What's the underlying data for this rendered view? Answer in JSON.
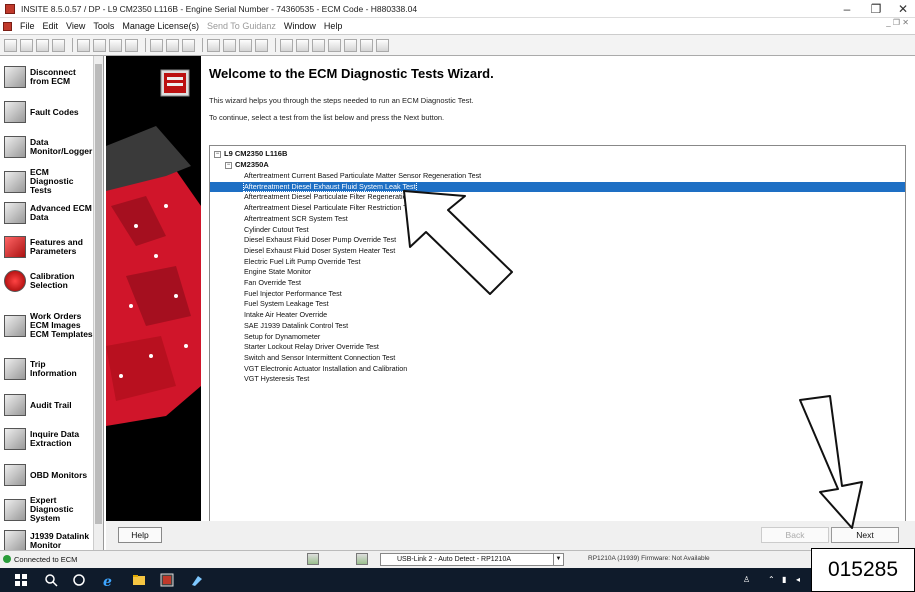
{
  "window": {
    "title": "INSITE 8.5.0.57 / DP - L9 CM2350 L116B - Engine Serial Number - 74360535 - ECM Code - H880338.04",
    "minimize": "–",
    "restore": "❐",
    "close": "✕"
  },
  "menubar": {
    "items": [
      "File",
      "Edit",
      "View",
      "Tools",
      "Manage License(s)",
      "Send To Guidanz",
      "Window",
      "Help"
    ],
    "window_controls": "_ ❐ ✕"
  },
  "sidebar": {
    "items": [
      {
        "label": "Disconnect from ECM",
        "icon": "disconnect-icon"
      },
      {
        "label": "Fault Codes",
        "icon": "fault-codes-icon"
      },
      {
        "label": "Data Monitor/Logger",
        "icon": "data-monitor-icon"
      },
      {
        "label": "ECM Diagnostic Tests",
        "icon": "diagnostic-tests-icon"
      },
      {
        "label": "Advanced ECM Data",
        "icon": "advanced-data-icon"
      },
      {
        "label": "Features and Parameters",
        "icon": "features-icon"
      },
      {
        "label": "Calibration Selection",
        "icon": "calibration-icon"
      },
      {
        "label": "Work Orders ECM Images ECM Templates",
        "icon": "work-orders-icon"
      },
      {
        "label": "Trip Information",
        "icon": "trip-icon"
      },
      {
        "label": "Audit Trail",
        "icon": "audit-icon"
      },
      {
        "label": "Inquire Data Extraction",
        "icon": "inquire-icon"
      },
      {
        "label": "OBD Monitors",
        "icon": "obd-icon"
      },
      {
        "label": "Expert Diagnostic System",
        "icon": "expert-icon"
      },
      {
        "label": "J1939 Datalink Monitor",
        "icon": "datalink-icon"
      }
    ]
  },
  "wizard": {
    "title": "Welcome to the ECM Diagnostic Tests Wizard.",
    "desc1": "This wizard helps you through the steps needed to run an ECM Diagnostic Test.",
    "desc2": "To continue, select a test from the list below and press the Next button.",
    "tree_root": "L9 CM2350 L116B",
    "tree_child": "CM2350A",
    "tests": [
      "Aftertreatment Current Based Particulate Matter Sensor Regeneration Test",
      "Aftertreatment Diesel Exhaust Fluid System Leak Test",
      "Aftertreatment Diesel Particulate Filter Regeneration",
      "Aftertreatment Diesel Particulate Filter Restriction Test",
      "Aftertreatment SCR System Test",
      "Cylinder Cutout Test",
      "Diesel Exhaust Fluid Doser Pump Override Test",
      "Diesel Exhaust Fluid Doser System Heater Test",
      "Electric Fuel Lift Pump Override Test",
      "Engine State Monitor",
      "Fan Override Test",
      "Fuel Injector Performance Test",
      "Fuel System Leakage Test",
      "Intake Air Heater Override",
      "SAE J1939 Datalink Control Test",
      "Setup for Dynamometer",
      "Starter Lockout Relay Driver Override Test",
      "Switch and Sensor Intermittent Connection Test",
      "VGT Electronic Actuator Installation and Calibration",
      "VGT Hysteresis Test"
    ],
    "selected_index": 1
  },
  "buttons": {
    "help": "Help",
    "back": "Back",
    "next": "Next"
  },
  "status": {
    "connection": "Connected to ECM",
    "adapter": "USB-Link 2 - Auto Detect - RP1210A",
    "firmware": "RP1210A (J1939) Firmware: Not Available"
  },
  "doc_number": "015285",
  "colors": {
    "selection": "#1e6fc4",
    "taskbar": "#0f1b2b",
    "engine_red": "#d0152a"
  }
}
